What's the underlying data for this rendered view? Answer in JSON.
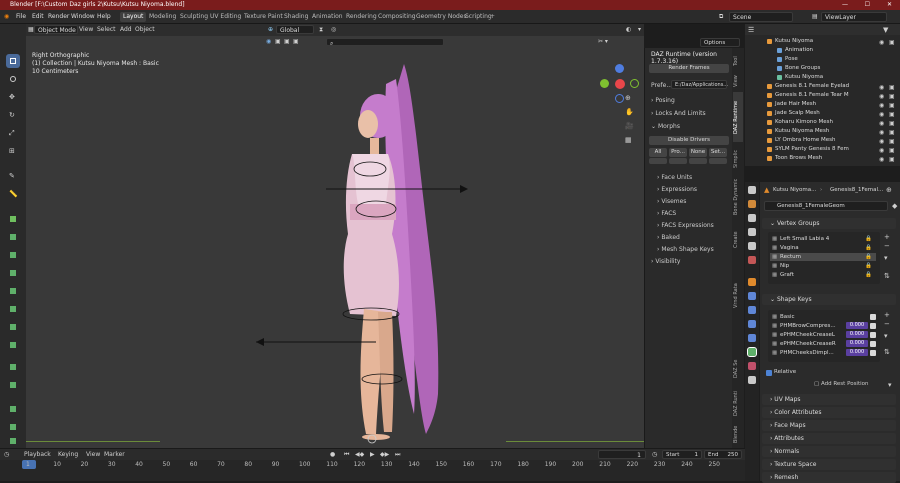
{
  "window": {
    "title": "Blender [F:\\Custom Daz girls 2\\Kutsu\\Kutsu Niyoma.blend]"
  },
  "menu": [
    "File",
    "Edit",
    "Render",
    "Window",
    "Help"
  ],
  "workspaces": [
    "Layout",
    "Modeling",
    "Sculpting",
    "UV Editing",
    "Texture Paint",
    "Shading",
    "Animation",
    "Rendering",
    "Compositing",
    "Geometry Nodes",
    "Scripting"
  ],
  "active_workspace": "Layout",
  "scene": {
    "name": "Scene",
    "view_layer": "ViewLayer"
  },
  "viewport_header": {
    "mode": "Object Mode",
    "menus": [
      "View",
      "Select",
      "Add",
      "Object"
    ],
    "orientation": "Global",
    "options": "Options"
  },
  "viewport_info": {
    "view": "Right Orthographic",
    "collection": "(1) Collection | Kutsu Niyoma Mesh : Basic",
    "scale": "10 Centimeters"
  },
  "daz_panel": {
    "title": "DAZ Runtime (version 1.7.3.16)",
    "render_frames": "Render Frames",
    "prefix_label": "Prefe...",
    "prefix_value": "E:/Daz/Applications...",
    "sections": [
      "Posing",
      "Locks And Limits",
      "Morphs"
    ],
    "disable_drivers": "Disable Drivers",
    "morph_buttons": [
      "All",
      "Pro...",
      "None",
      "Set..."
    ],
    "morph_categories": [
      "Face Units",
      "Expressions",
      "Visemes",
      "FACS",
      "FACS Expressions",
      "Baked",
      "Mesh Shape Keys"
    ],
    "visibility": "Visibility"
  },
  "side_tabs": [
    "Tool",
    "View",
    "DAZ Runtime",
    "Simplic",
    "Bone Dynamic",
    "Create",
    "Vrnd Rata",
    "DAZ Se",
    "DAZ Runti",
    "Blende"
  ],
  "outliner": [
    {
      "name": "Kutsu Niyoma",
      "indent": 1,
      "color": "#e89a3c"
    },
    {
      "name": "Animation",
      "indent": 2,
      "color": "#6aa0d8"
    },
    {
      "name": "Pose",
      "indent": 2,
      "color": "#6aa0d8"
    },
    {
      "name": "Bone Groups",
      "indent": 2,
      "color": "#6aa0d8"
    },
    {
      "name": "Kutsu Niyoma",
      "indent": 2,
      "color": "#6ac0a0"
    },
    {
      "name": "Genesis 8.1 Female Eyelad",
      "indent": 1,
      "color": "#e89a3c"
    },
    {
      "name": "Genesis 8.1 Female Tear M",
      "indent": 1,
      "color": "#e89a3c"
    },
    {
      "name": "Jade Hair Mesh",
      "indent": 1,
      "color": "#e89a3c"
    },
    {
      "name": "Jade Scalp Mesh",
      "indent": 1,
      "color": "#e89a3c"
    },
    {
      "name": "Koharu Kimono Mesh",
      "indent": 1,
      "color": "#e89a3c"
    },
    {
      "name": "Kutsu Niyoma Mesh",
      "indent": 1,
      "color": "#e89a3c"
    },
    {
      "name": "LY Ombra Home Mesh",
      "indent": 1,
      "color": "#e89a3c"
    },
    {
      "name": "SYLM Panty Genesis 8 Fem",
      "indent": 1,
      "color": "#e89a3c"
    },
    {
      "name": "Toon Brows Mesh",
      "indent": 1,
      "color": "#e89a3c"
    }
  ],
  "properties": {
    "breadcrumb_object": "Kutsu Niyoma...",
    "breadcrumb_data": "Genesis8_1Femal...",
    "mesh_name": "Genesis8_1FemaleGeom",
    "vertex_groups_title": "Vertex Groups",
    "vertex_groups": [
      "Left Small Labia 4",
      "Vagina",
      "Rectum",
      "Nip",
      "Graft"
    ],
    "shape_keys_title": "Shape Keys",
    "shape_keys": [
      {
        "name": "Basic",
        "value": ""
      },
      {
        "name": "PHMBrowCompres...",
        "value": "0.000"
      },
      {
        "name": "ePHMCheekCreaseL",
        "value": "0.000"
      },
      {
        "name": "ePHMCheekCreaseR",
        "value": "0.000"
      },
      {
        "name": "PHMCheeksDimpl...",
        "value": "0.000"
      }
    ],
    "relative": "Relative",
    "add_rest_position": "Add Rest Position",
    "collapsed_sections": [
      "UV Maps",
      "Color Attributes",
      "Face Maps",
      "Attributes",
      "Normals",
      "Texture Space",
      "Remesh"
    ]
  },
  "timeline": {
    "menus": [
      "Playback",
      "Keying",
      "View",
      "Marker"
    ],
    "current_frame": "1",
    "start_label": "Start",
    "start": "1",
    "end_label": "End",
    "end": "250",
    "ticks": [
      "1",
      "10",
      "20",
      "30",
      "40",
      "50",
      "60",
      "70",
      "80",
      "90",
      "100",
      "110",
      "120",
      "130",
      "140",
      "150",
      "160",
      "170",
      "180",
      "190",
      "200",
      "210",
      "220",
      "230",
      "240",
      "250"
    ]
  }
}
